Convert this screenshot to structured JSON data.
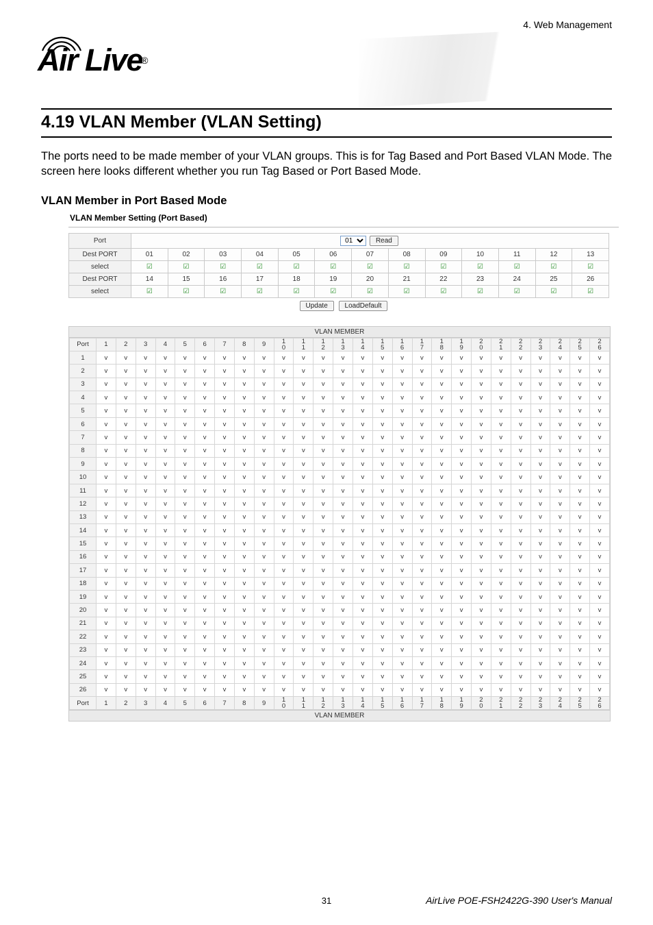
{
  "header": {
    "breadcrumb": "4.  Web Management"
  },
  "logo": {
    "brand_prefix": "A",
    "brand_mid": "ir L",
    "brand_suffix": "ive"
  },
  "section_title": "4.19 VLAN Member (VLAN Setting)",
  "intro_paragraph": "The ports need to be made member of your VLAN groups. This is for Tag Based and Port Based VLAN Mode. The screen here looks different whether you run Tag Based or Port Based Mode.",
  "subheading": "VLAN Member in Port Based Mode",
  "ss": {
    "title": "VLAN Member Setting (Port Based)",
    "port_label": "Port",
    "destport_label": "Dest PORT",
    "select_label": "select",
    "dropdown_value": "01",
    "read_button": "Read",
    "update_button": "Update",
    "loaddefault_button": "LoadDefault",
    "row1": [
      "01",
      "02",
      "03",
      "04",
      "05",
      "06",
      "07",
      "08",
      "09",
      "10",
      "11",
      "12",
      "13"
    ],
    "row2": [
      "14",
      "15",
      "16",
      "17",
      "18",
      "19",
      "20",
      "21",
      "22",
      "23",
      "24",
      "25",
      "26"
    ]
  },
  "matrix": {
    "header_label": "VLAN MEMBER",
    "port_label": "Port",
    "cols": [
      "1",
      "2",
      "3",
      "4",
      "5",
      "6",
      "7",
      "8",
      "9",
      "10",
      "11",
      "12",
      "13",
      "14",
      "15",
      "16",
      "17",
      "18",
      "19",
      "20",
      "21",
      "22",
      "23",
      "24",
      "25",
      "26"
    ],
    "rows": 26
  },
  "footer": {
    "page_number": "31",
    "manual_title": "AirLive POE-FSH2422G-390 User's Manual"
  },
  "chart_data": {
    "type": "table",
    "title": "VLAN MEMBER (Port Based) — every cell = 'v'",
    "row_labels": [
      "1",
      "2",
      "3",
      "4",
      "5",
      "6",
      "7",
      "8",
      "9",
      "10",
      "11",
      "12",
      "13",
      "14",
      "15",
      "16",
      "17",
      "18",
      "19",
      "20",
      "21",
      "22",
      "23",
      "24",
      "25",
      "26"
    ],
    "col_labels": [
      "1",
      "2",
      "3",
      "4",
      "5",
      "6",
      "7",
      "8",
      "9",
      "10",
      "11",
      "12",
      "13",
      "14",
      "15",
      "16",
      "17",
      "18",
      "19",
      "20",
      "21",
      "22",
      "23",
      "24",
      "25",
      "26"
    ],
    "uniform_value": "v"
  }
}
